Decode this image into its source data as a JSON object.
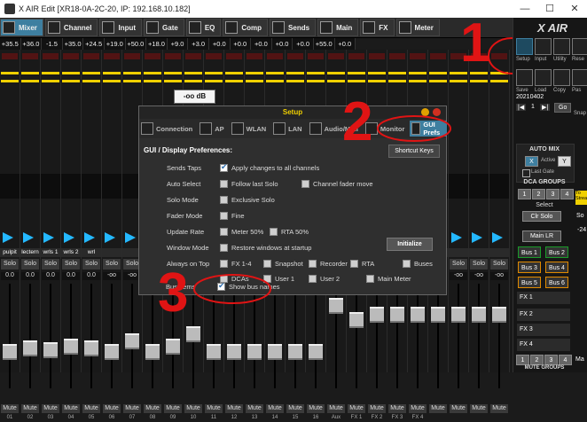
{
  "window": {
    "title": "X AIR Edit [XR18-0A-2C-20, IP: 192.168.10.182]",
    "minimize": "—",
    "maximize": "☐",
    "close": "✕"
  },
  "tabs": [
    {
      "label": "Mixer",
      "active": true
    },
    {
      "label": "Channel"
    },
    {
      "label": "Input"
    },
    {
      "label": "Gate"
    },
    {
      "label": "EQ"
    },
    {
      "label": "Comp"
    },
    {
      "label": "Sends"
    },
    {
      "label": "Main"
    },
    {
      "label": "FX"
    },
    {
      "label": "Meter"
    }
  ],
  "gain_values": [
    "+35.5",
    "+36.0",
    "-1.5",
    "+35.0",
    "+24.5",
    "+19.0",
    "+50.0",
    "+18.0",
    "+9.0",
    "+3.0",
    "+0.0",
    "+0.0",
    "+0.0",
    "+0.0",
    "+0.0",
    "+55.0",
    "+0.0"
  ],
  "fader_tooltip": "-oo dB",
  "channel_names": [
    "pulpit",
    "lectern",
    "wrls 1",
    "wrls 2",
    "wrl",
    "",
    "",
    "",
    "",
    "",
    "",
    "",
    "",
    "",
    "",
    "FX 2",
    "FX 3",
    "FX 4"
  ],
  "solo_label": "Solo",
  "mute_label": "Mute",
  "channel_gains": [
    "0.0",
    "0.0",
    "0.0",
    "0.0",
    "0.0"
  ],
  "gain_minus_inf": "-oo",
  "channel_numbers": [
    "01",
    "02",
    "03",
    "04",
    "05",
    "06",
    "07",
    "08",
    "09",
    "10",
    "11",
    "12",
    "13",
    "14",
    "15",
    "16",
    "Aux",
    "FX 1",
    "FX 2",
    "FX 3",
    "FX 4"
  ],
  "dialog": {
    "title": "Setup",
    "tabs": [
      {
        "label": "Connection"
      },
      {
        "label": "AP"
      },
      {
        "label": "WLAN"
      },
      {
        "label": "LAN"
      },
      {
        "label": "Audio/Midi"
      },
      {
        "label": "Monitor"
      },
      {
        "label": "GUI Prefs",
        "active": true
      }
    ],
    "section_title": "GUI / Display Preferences:",
    "shortcut_keys": "Shortcut Keys",
    "rows": {
      "sends_taps": {
        "label": "Sends Taps",
        "opt1": "Apply changes to all channels"
      },
      "auto_select": {
        "label": "Auto Select",
        "opt1": "Follow last Solo",
        "opt2": "Channel fader move"
      },
      "solo_mode": {
        "label": "Solo Mode",
        "opt1": "Exclusive Solo"
      },
      "fader_mode": {
        "label": "Fader Mode",
        "opt1": "Fine"
      },
      "update_rate": {
        "label": "Update Rate",
        "opt1": "Meter 50%",
        "opt2": "RTA 50%"
      },
      "window_mode": {
        "label": "Window Mode",
        "opt1": "Restore windows at startup"
      },
      "always_on_top": {
        "label": "Always on Top",
        "opt1": "FX 1-4",
        "opt2": "Snapshot",
        "opt3": "Recorder",
        "opt4": "RTA",
        "opt5": "Buses"
      },
      "extra": {
        "opt1": "DCAs",
        "opt2": "User 1",
        "opt3": "User 2",
        "opt4": "Main Meter"
      },
      "bus_items": {
        "label": "Bus Items",
        "opt1": "Show bus names"
      }
    },
    "initialize": "Initialize"
  },
  "annotations": {
    "n1": "1",
    "n2": "2",
    "n3": "3"
  },
  "right_panel": {
    "logo": "X AIR",
    "buttons": [
      "Setup",
      "Input",
      "Utility",
      "Rese"
    ],
    "row2": [
      "Save",
      "Load",
      "Copy",
      "Pas"
    ],
    "date": "20210402",
    "snapshot_nav": [
      "1",
      "Go"
    ],
    "snap_label": "Snap",
    "auto_mix": "AUTO MIX",
    "auto_x": "X",
    "active": "Active",
    "auto_y": "Y",
    "last_gate": "Last Gate",
    "dca_groups": "DCA GROUPS",
    "dca_nums": [
      "1",
      "2",
      "3",
      "4"
    ],
    "to_stream": "To Strea",
    "select": "Select",
    "clr_solo": "Clr Solo",
    "so": "So",
    "main_lr": "Main LR",
    "val": "-24",
    "buses": [
      "Bus 1",
      "Bus 2",
      "Bus 3",
      "Bus 4",
      "Bus 5",
      "Bus 6"
    ],
    "fx": [
      "FX 1",
      "FX 2",
      "FX 3",
      "FX 4"
    ],
    "mute_groups": "MUTE GROUPS",
    "mute_nums": [
      "1",
      "2",
      "3",
      "4"
    ],
    "ma": "Ma"
  },
  "colors": {
    "accent": "#3e7fa0",
    "yellow": "#f0d000",
    "annotation": "#e01414",
    "bus_green": "#1a9a2a",
    "bus_orange": "#e08a00"
  }
}
